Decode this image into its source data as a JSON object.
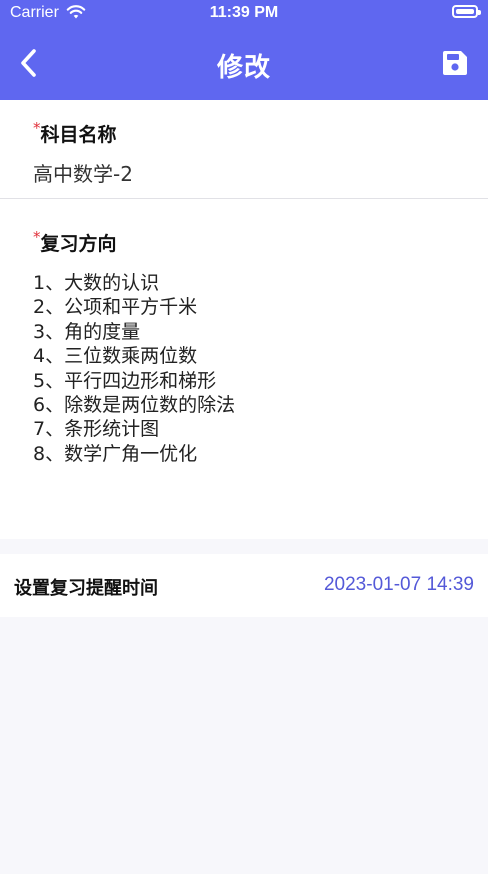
{
  "status_bar": {
    "carrier": "Carrier",
    "time": "11:39 PM",
    "icons": [
      "wifi-icon",
      "battery-icon"
    ]
  },
  "nav": {
    "title": "修改",
    "back_icon": "chevron-left-icon",
    "save_icon": "floppy-disk-icon"
  },
  "form": {
    "required_mark": "*",
    "subject": {
      "label": "科目名称",
      "value": "高中数学-2"
    },
    "review_direction": {
      "label": "复习方向",
      "items": [
        "1、大数的认识",
        "2、公项和平方千米",
        "3、角的度量",
        "4、三位数乘两位数",
        "5、平行四边形和梯形",
        "6、除数是两位数的除法",
        "7、条形统计图",
        "8、数学广角一优化"
      ]
    },
    "reminder": {
      "label": "设置复习提醒时间",
      "value": "2023-01-07 14:39"
    }
  },
  "colors": {
    "header_bg": "#5f67f0",
    "accent": "#5459d8",
    "required": "#e0303a",
    "page_bg": "#f7f7fb"
  }
}
